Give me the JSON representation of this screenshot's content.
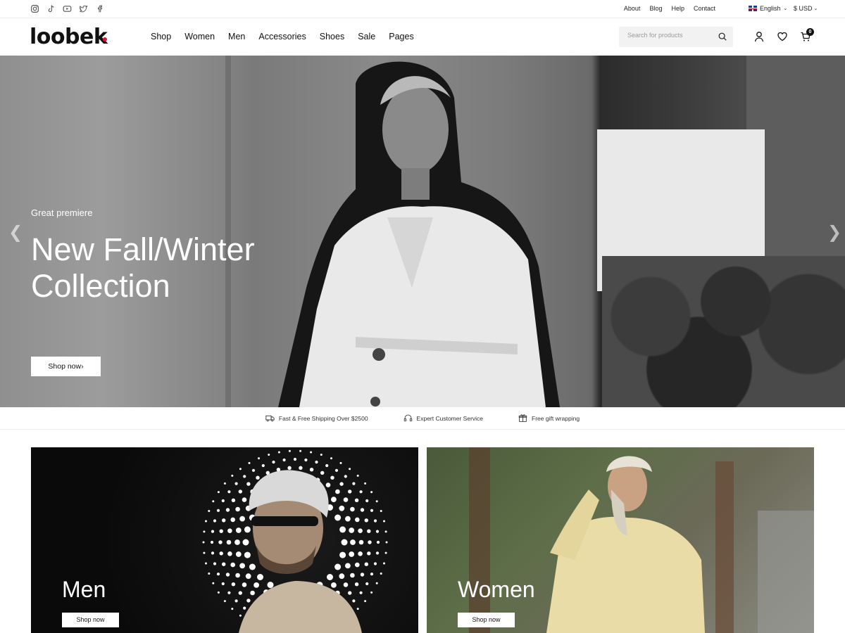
{
  "topbar": {
    "social_icons": [
      "instagram-icon",
      "tiktok-icon",
      "youtube-icon",
      "twitter-icon",
      "facebook-icon"
    ],
    "links": [
      "About",
      "Blog",
      "Help",
      "Contact"
    ],
    "language": "English",
    "currency": "$ USD"
  },
  "header": {
    "logo": "loobek",
    "accent_color": "#d6163a",
    "nav": [
      "Shop",
      "Women",
      "Men",
      "Accessories",
      "Shoes",
      "Sale",
      "Pages"
    ],
    "search_placeholder": "Search for products",
    "cart_count": "0"
  },
  "hero": {
    "subtitle": "Great premiere",
    "title": "New Fall/Winter Collection",
    "button": "Shop now"
  },
  "features": [
    {
      "icon": "truck-icon",
      "text": "Fast & Free Shipping Over $2500"
    },
    {
      "icon": "headset-icon",
      "text": "Expert Customer Service"
    },
    {
      "icon": "gift-icon",
      "text": "Free gift wrapping"
    }
  ],
  "categories": [
    {
      "title": "Men",
      "button": "Shop now"
    },
    {
      "title": "Women",
      "button": "Shop now"
    }
  ]
}
